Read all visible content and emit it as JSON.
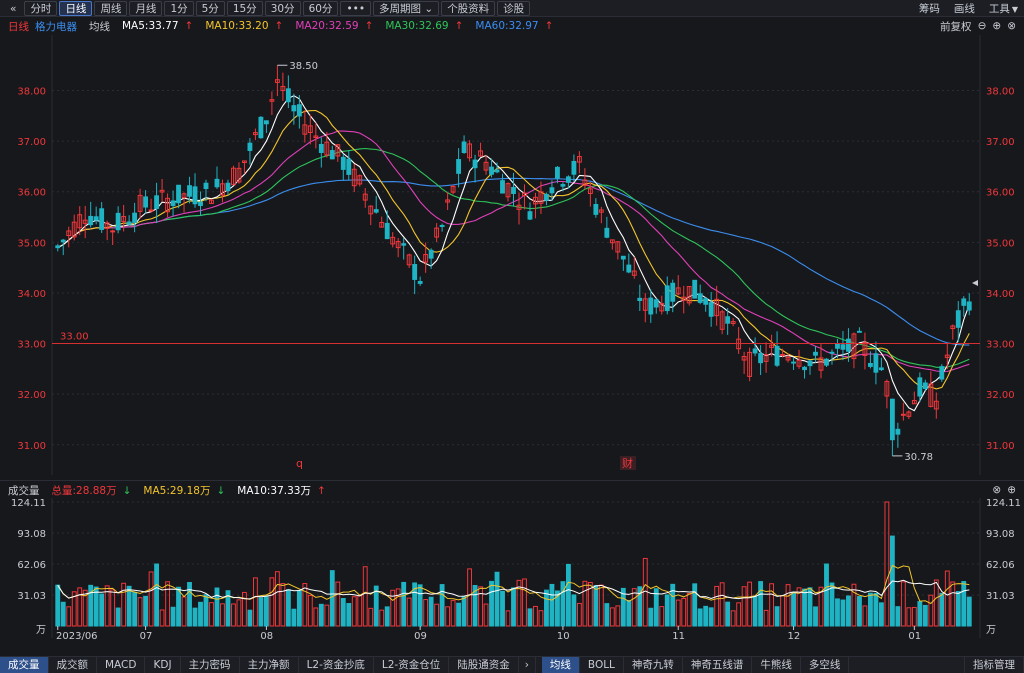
{
  "toolbar": {
    "back_icon": "double-chevron-left-icon",
    "buttons": [
      "分时",
      "日线",
      "周线",
      "月线",
      "1分",
      "5分",
      "15分",
      "30分",
      "60分",
      "•••",
      "多周期图",
      "个股资料",
      "诊股"
    ],
    "active": "日线",
    "right": [
      "筹码",
      "画线",
      "工具"
    ]
  },
  "ma_header": {
    "period": "日线",
    "stock": "格力电器",
    "type": "均线",
    "ma5": "MA5:33.77",
    "ma10": "MA10:33.20",
    "ma20": "MA20:32.59",
    "ma30": "MA30:32.69",
    "ma60": "MA60:32.97",
    "adjust": "前复权"
  },
  "vol_header": {
    "label": "成交量",
    "total": "总量:28.88万",
    "ma5": "MA5:29.18万",
    "ma10": "MA10:37.33万"
  },
  "colors": {
    "up": "#f0373a",
    "down": "#1fb4c4",
    "ma5": "#ffffff",
    "ma10": "#f3c52b",
    "ma20": "#e040b8",
    "ma30": "#2ec45a",
    "ma60": "#3b8ef0",
    "grid": "#2a2d35"
  },
  "price_axis": {
    "ticks": [
      "38.00",
      "37.00",
      "36.00",
      "35.00",
      "34.00",
      "33.00",
      "32.00",
      "31.00"
    ],
    "ref_line": "33.00",
    "high_label": "38.50",
    "low_label": "30.78",
    "markers": [
      "q",
      "财"
    ]
  },
  "vol_axis": {
    "ticks": [
      "124.11",
      "93.08",
      "62.06",
      "31.03"
    ],
    "unit": "万"
  },
  "x_axis": {
    "labels": [
      "2023/06",
      "07",
      "08",
      "09",
      "10",
      "11",
      "12",
      "01"
    ]
  },
  "chart_data": {
    "type": "candlestick",
    "ylim": [
      30.6,
      38.9
    ],
    "vol_ylim": [
      0,
      124.11
    ],
    "ref_line": 33.0,
    "high": 38.5,
    "low": 30.78,
    "ma_last": {
      "ma5": 33.77,
      "ma10": 33.2,
      "ma20": 32.59,
      "ma30": 32.69,
      "ma60": 32.97
    },
    "vol_last": {
      "total": 28.88,
      "ma5": 29.18,
      "ma10": 37.33
    },
    "month_ticks": [
      "2023/06",
      "07",
      "08",
      "09",
      "10",
      "11",
      "12",
      "01"
    ]
  },
  "bottom_tabs": {
    "left": [
      "成交量",
      "成交额",
      "MACD",
      "KDJ",
      "主力密码",
      "主力净额",
      "L2-资金抄底",
      "L2-资金仓位",
      "陆股通资金"
    ],
    "left_active": "成交量",
    "right": [
      "均线",
      "BOLL",
      "神奇九转",
      "神奇五线谱",
      "牛熊线",
      "多空线",
      "指标管理"
    ],
    "right_active": "均线"
  }
}
